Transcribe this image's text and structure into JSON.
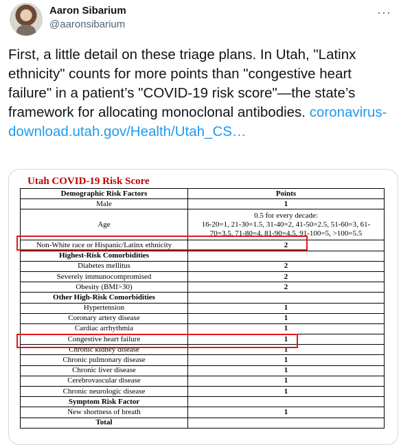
{
  "author": {
    "name": "Aaron Sibarium",
    "handle": "@aaronsibarium"
  },
  "more_icon": "more-horizontal-icon",
  "tweet": {
    "text": "First, a little detail on these triage plans. In Utah, \"Latinx ethnicity\" counts for more points than \"congestive heart failure\" in a patient’s \"COVID-19 risk score\"—the state’s framework for allocating monoclonal antibodies.",
    "link": "coronavirus-download.utah.gov/Health/Utah_CS…"
  },
  "doc": {
    "title": "Utah COVID-19 Risk Score",
    "headers": [
      "Demographic Risk Factors",
      "Points"
    ],
    "male": {
      "label": "Male",
      "points": "1"
    },
    "age": {
      "label": "Age",
      "heading": "0.5 for every decade:",
      "line1": "16-20=1, 21-30=1.5, 31-40=2, 41-50=2.5, 51-60=3, 61-",
      "line2": "70=3.5, 71-80=4, 81-90=4.5, 91-100=5, >100=5.5"
    },
    "race": {
      "label": "Non-White race or Hispanic/Latinx ethnicity",
      "points": "2"
    },
    "section_high": "Highest-Risk Comorbidities",
    "high_rows": [
      {
        "label": "Diabetes mellitus",
        "points": "2"
      },
      {
        "label": "Severely immunocompromised",
        "points": "2"
      },
      {
        "label": "Obesity (BMI>30)",
        "points": "2"
      }
    ],
    "section_other": "Other High-Risk Comorbidities",
    "other_rows": [
      {
        "label": "Hypertension",
        "points": "1"
      },
      {
        "label": "Coronary artery disease",
        "points": "1"
      },
      {
        "label": "Cardiac arrhythmia",
        "points": "1"
      },
      {
        "label": "Congestive heart failure",
        "points": "1"
      },
      {
        "label": "Chronic kidney disease",
        "points": "1"
      },
      {
        "label": "Chronic pulmonary disease",
        "points": "1"
      },
      {
        "label": "Chronic liver disease",
        "points": "1"
      },
      {
        "label": "Cerebrovascular disease",
        "points": "1"
      },
      {
        "label": "Chronic neurologic disease",
        "points": "1"
      }
    ],
    "section_symptom": "Symptom Risk Factor",
    "symptom_rows": [
      {
        "label": "New shortness of breath",
        "points": "1"
      }
    ],
    "total_label": "Total",
    "total_points": ""
  },
  "colors": {
    "link": "#1d9bf0",
    "title_red": "#c00000",
    "highlight": "#e3151a"
  }
}
